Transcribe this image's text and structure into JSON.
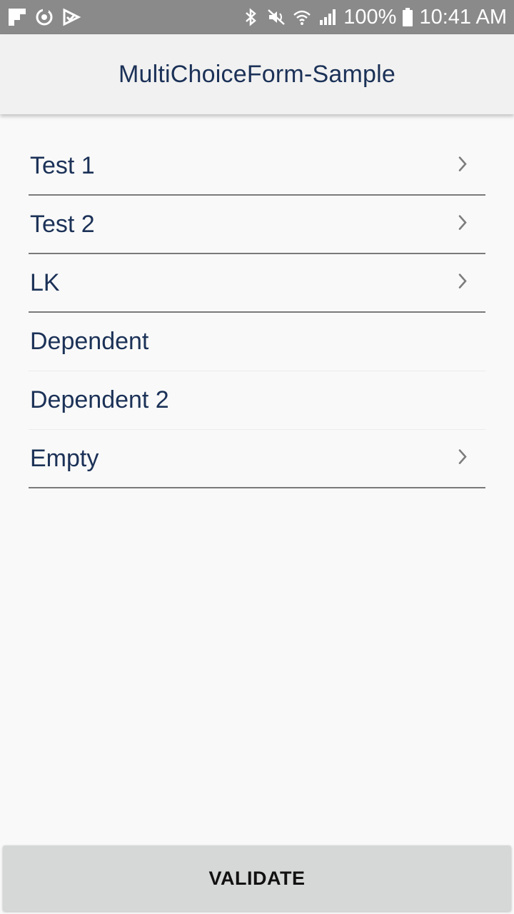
{
  "status_bar": {
    "battery": "100%",
    "time": "10:41 AM",
    "left_icons": [
      "flipboard-icon",
      "sync-icon",
      "check-flag-icon"
    ],
    "right_icons": [
      "bluetooth-icon",
      "mute-icon",
      "wifi-icon",
      "signal-icon",
      "battery-icon"
    ]
  },
  "app_bar": {
    "title": "MultiChoiceForm-Sample"
  },
  "list": {
    "items": [
      {
        "label": "Test 1",
        "has_chevron": true
      },
      {
        "label": "Test 2",
        "has_chevron": true
      },
      {
        "label": "LK",
        "has_chevron": true
      },
      {
        "label": "Dependent",
        "has_chevron": false
      },
      {
        "label": "Dependent 2",
        "has_chevron": false
      },
      {
        "label": "Empty",
        "has_chevron": true
      }
    ]
  },
  "footer": {
    "validate_label": "VALIDATE"
  },
  "colors": {
    "status_bar_bg": "#8a8a8a",
    "app_bar_bg": "#f1f1f1",
    "text_primary": "#1b3157",
    "chevron": "#7d7d7d",
    "button_bg": "#d6d7d7"
  }
}
